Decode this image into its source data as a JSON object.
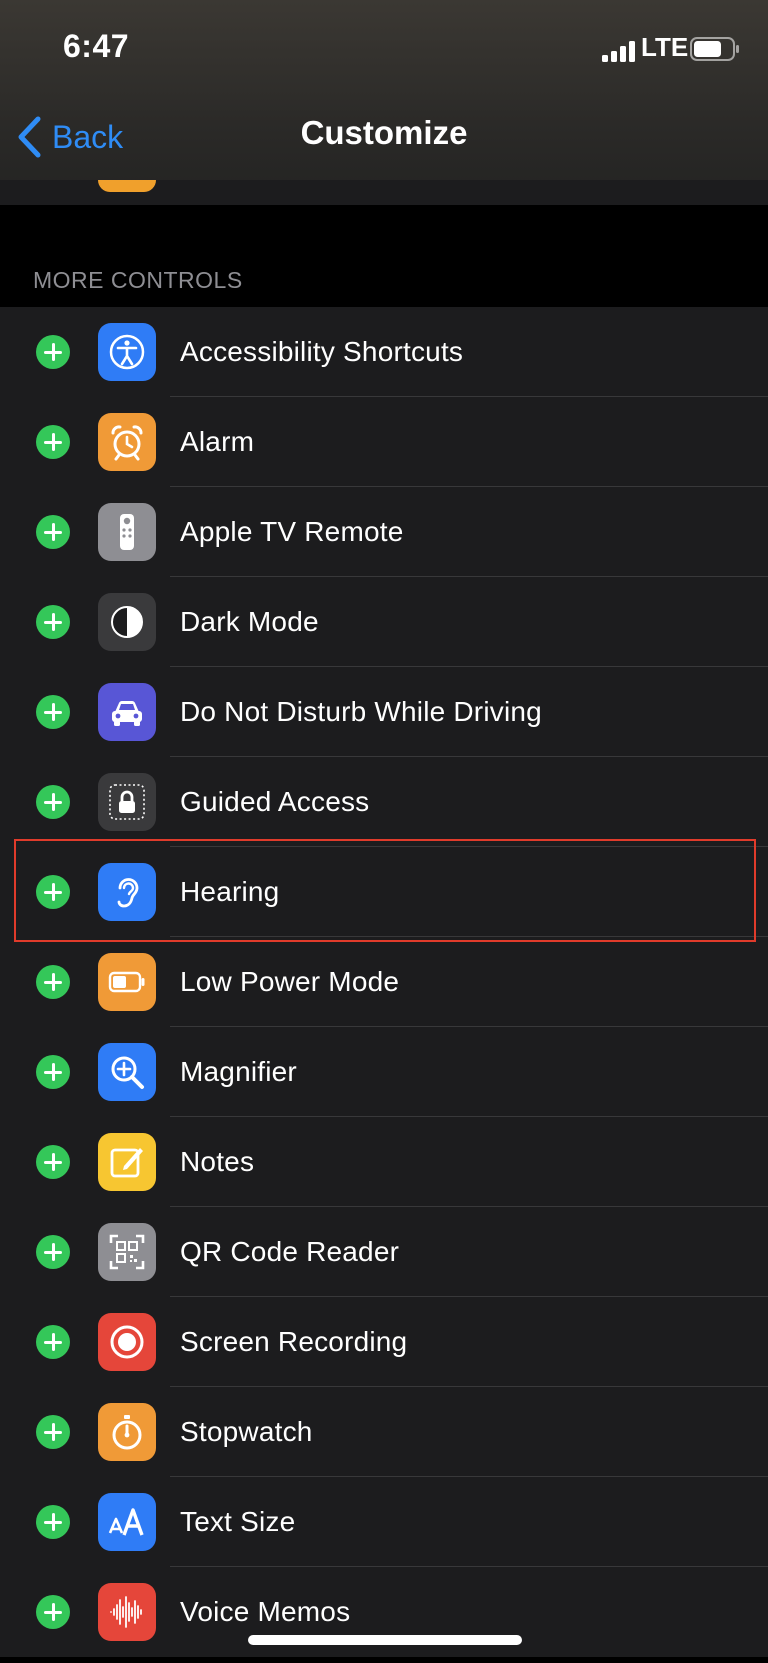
{
  "status_bar": {
    "time": "6:47",
    "network": "LTE"
  },
  "nav": {
    "back_label": "Back",
    "title": "Customize"
  },
  "section": {
    "label": "MORE CONTROLS"
  },
  "controls": [
    {
      "label": "Accessibility Shortcuts",
      "icon": "accessibility-icon",
      "color": "#2f7cf6"
    },
    {
      "label": "Alarm",
      "icon": "alarm-clock-icon",
      "color": "#f09a37"
    },
    {
      "label": "Apple TV Remote",
      "icon": "tv-remote-icon",
      "color": "#8e8e93"
    },
    {
      "label": "Dark Mode",
      "icon": "dark-mode-icon",
      "color": "#3a3a3c"
    },
    {
      "label": "Do Not Disturb While Driving",
      "icon": "car-icon",
      "color": "#5856d6"
    },
    {
      "label": "Guided Access",
      "icon": "lock-icon",
      "color": "#3a3a3c"
    },
    {
      "label": "Hearing",
      "icon": "ear-icon",
      "color": "#2f7cf6"
    },
    {
      "label": "Low Power Mode",
      "icon": "battery-icon",
      "color": "#f09a37"
    },
    {
      "label": "Magnifier",
      "icon": "magnifier-icon",
      "color": "#2f7cf6"
    },
    {
      "label": "Notes",
      "icon": "notes-icon",
      "color": "#f7c631"
    },
    {
      "label": "QR Code Reader",
      "icon": "qr-code-icon",
      "color": "#8e8e93"
    },
    {
      "label": "Screen Recording",
      "icon": "record-icon",
      "color": "#e5463a"
    },
    {
      "label": "Stopwatch",
      "icon": "stopwatch-icon",
      "color": "#f09a37"
    },
    {
      "label": "Text Size",
      "icon": "text-size-icon",
      "color": "#2f7cf6"
    },
    {
      "label": "Voice Memos",
      "icon": "waveform-icon",
      "color": "#e5463a"
    }
  ],
  "highlighted_control": "Hearing",
  "colors": {
    "add_button": "#34c759",
    "accent": "#2f8cf5",
    "highlight_box": "#e03b2b"
  }
}
